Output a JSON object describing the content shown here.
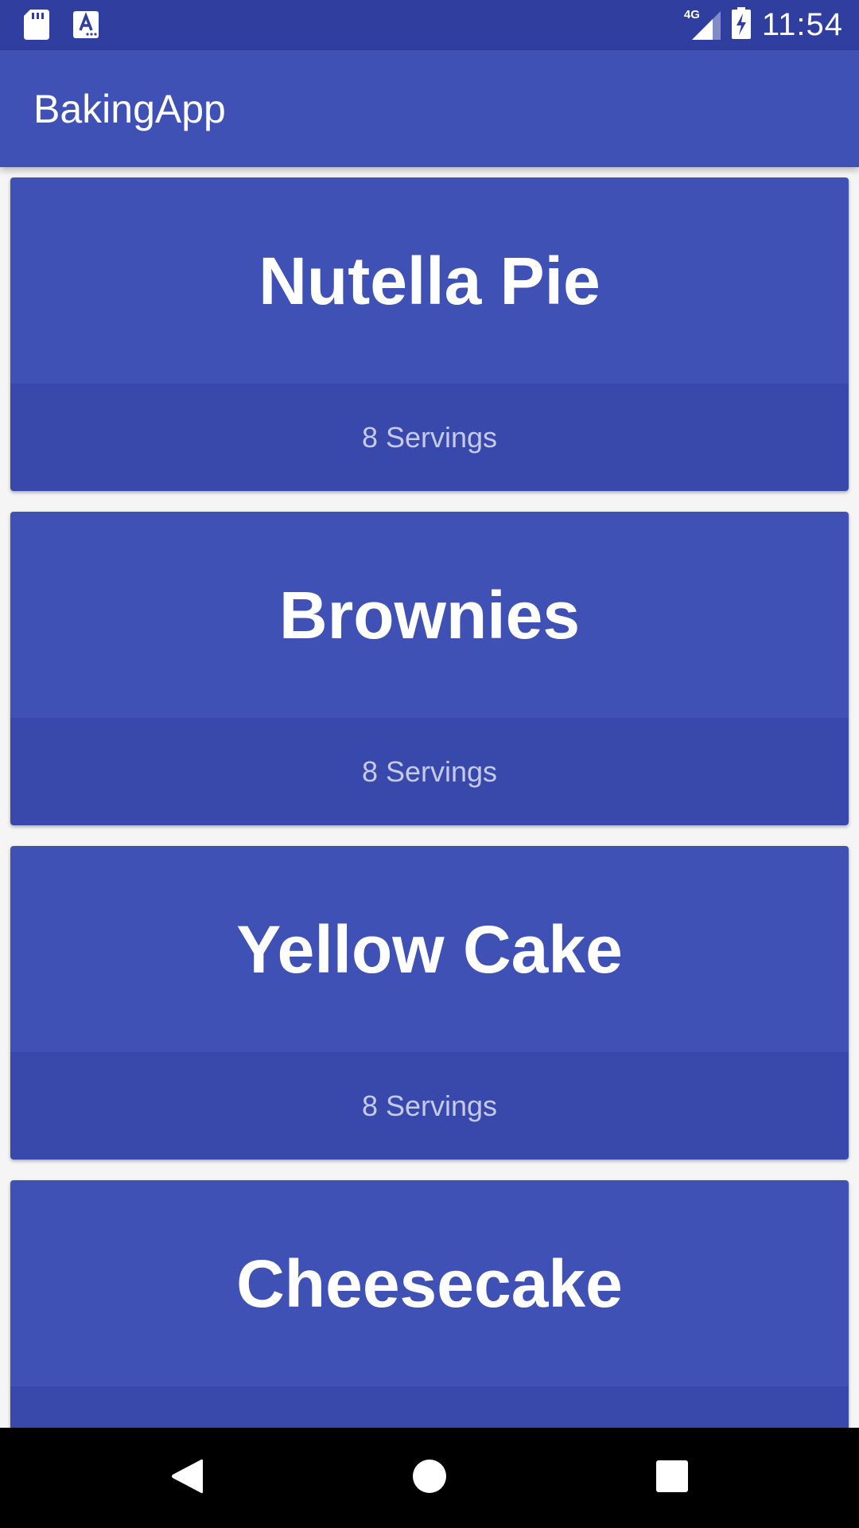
{
  "status_bar": {
    "time": "11:54",
    "network": "4G",
    "icons": [
      "sd-card-icon",
      "app-notification-icon",
      "signal-icon",
      "battery-charging-icon"
    ]
  },
  "app_bar": {
    "title": "BakingApp"
  },
  "recipes": [
    {
      "name": "Nutella Pie",
      "servings": "8 Servings"
    },
    {
      "name": "Brownies",
      "servings": "8 Servings"
    },
    {
      "name": "Yellow Cake",
      "servings": "8 Servings"
    },
    {
      "name": "Cheesecake",
      "servings": ""
    }
  ],
  "nav_bar": {
    "icons": [
      "back-icon",
      "home-icon",
      "recents-icon"
    ]
  },
  "colors": {
    "primary": "#3f51b5",
    "primary_dark": "#303f9f",
    "card_footer": "#3949ab"
  }
}
